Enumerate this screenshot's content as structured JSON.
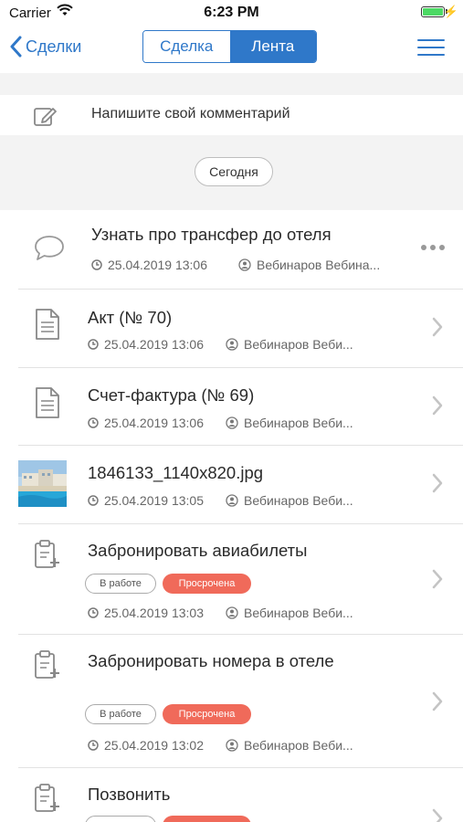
{
  "status": {
    "carrier": "Carrier",
    "time": "6:23 PM"
  },
  "nav": {
    "back_label": "Сделки",
    "tabs": [
      {
        "label": "Сделка",
        "active": false
      },
      {
        "label": "Лента",
        "active": true
      }
    ],
    "accent": "#2f78c9"
  },
  "comment": {
    "placeholder": "Напишите свой комментарий"
  },
  "date_pill": "Сегодня",
  "items": [
    {
      "icon": "comment-icon",
      "title": "Узнать про трансфер до отеля",
      "date": "25.04.2019 13:06",
      "user": "Вебинаров Вебина..."
    },
    {
      "icon": "document-icon",
      "title": "Акт (№ 70)",
      "date": "25.04.2019 13:06",
      "user": "Вебинаров Веби..."
    },
    {
      "icon": "document-icon",
      "title": "Счет-фактура (№ 69)",
      "date": "25.04.2019 13:06",
      "user": "Вебинаров Веби..."
    },
    {
      "icon": "image-thumbnail",
      "title": "1846133_1140x820.jpg",
      "date": "25.04.2019 13:05",
      "user": "Вебинаров Веби..."
    },
    {
      "icon": "task-icon",
      "title": "Забронировать авиабилеты",
      "status": "В работе",
      "overdue": "Просрочена",
      "date": "25.04.2019 13:03",
      "user": "Вебинаров Веби..."
    },
    {
      "icon": "task-icon",
      "title": "Забронировать номера в отеле",
      "status": "В работе",
      "overdue": "Просрочена",
      "date": "25.04.2019 13:02",
      "user": "Вебинаров Веби..."
    },
    {
      "icon": "task-icon",
      "title": "Позвонить"
    }
  ],
  "colors": {
    "overdue": "#f06a5a",
    "separator": "#e2e2e2",
    "background_gray": "#f3f3f3"
  }
}
